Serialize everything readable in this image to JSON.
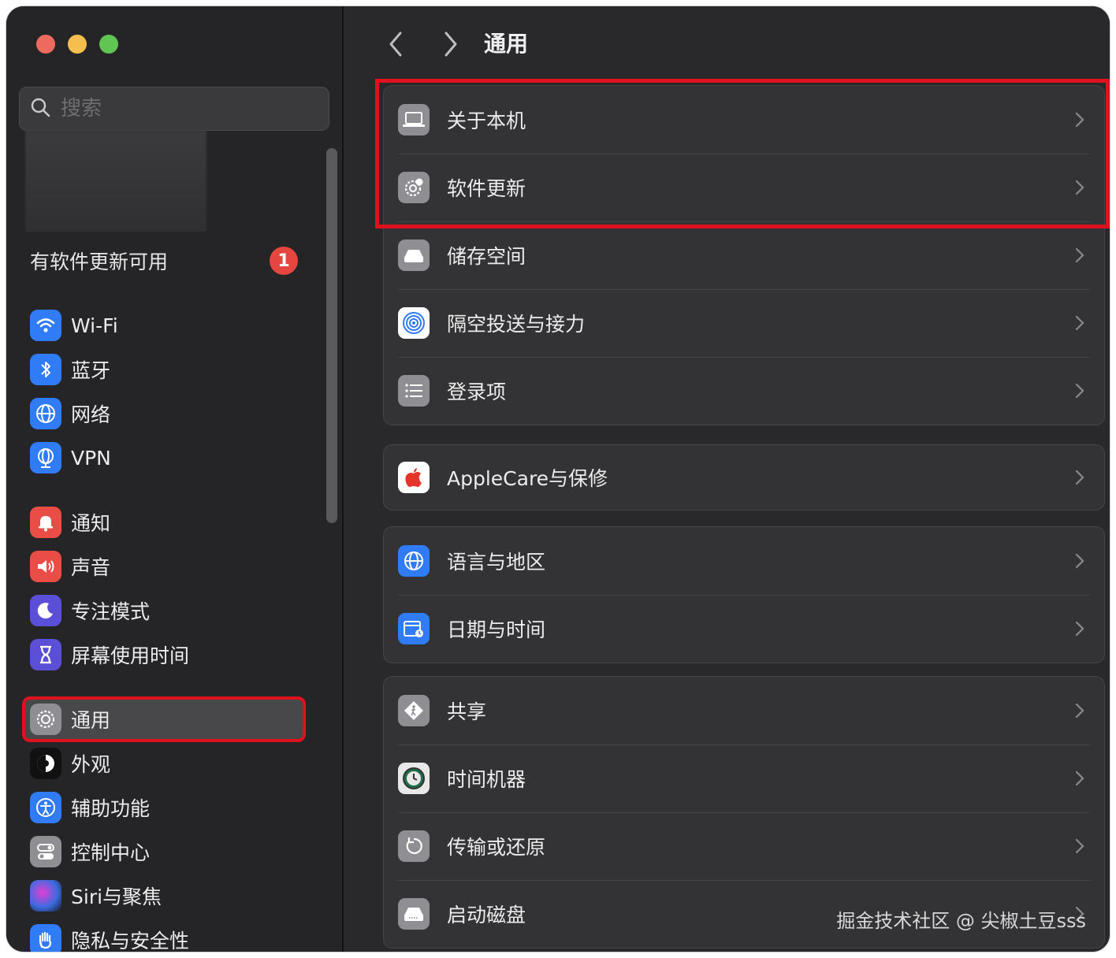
{
  "sidebar": {
    "search_placeholder": "搜索",
    "update_text": "有软件更新可用",
    "update_badge": "1",
    "items": [
      {
        "label": "Wi-Fi",
        "icon": "wifi-icon",
        "color": "#2f7cf6"
      },
      {
        "label": "蓝牙",
        "icon": "bluetooth-icon",
        "color": "#2f7cf6"
      },
      {
        "label": "网络",
        "icon": "globe-icon",
        "color": "#2f7cf6"
      },
      {
        "label": "VPN",
        "icon": "vpn-globe-icon",
        "color": "#2f7cf6"
      },
      {
        "label": "通知",
        "icon": "bell-icon",
        "color": "#ea4d46"
      },
      {
        "label": "声音",
        "icon": "speaker-icon",
        "color": "#ea4d46"
      },
      {
        "label": "专注模式",
        "icon": "moon-icon",
        "color": "#5b4fd8"
      },
      {
        "label": "屏幕使用时间",
        "icon": "hourglass-icon",
        "color": "#5b4fd8"
      },
      {
        "label": "通用",
        "icon": "gear-icon",
        "color": "#8e8e93"
      },
      {
        "label": "外观",
        "icon": "appearance-icon",
        "color": "#111111"
      },
      {
        "label": "辅助功能",
        "icon": "accessibility-icon",
        "color": "#2f7cf6"
      },
      {
        "label": "控制中心",
        "icon": "toggles-icon",
        "color": "#8e8e93"
      },
      {
        "label": "Siri与聚焦",
        "icon": "siri-icon",
        "color": "#4a3fb0"
      },
      {
        "label": "隐私与安全性",
        "icon": "hand-icon",
        "color": "#2f7cf6"
      }
    ]
  },
  "main": {
    "title": "通用",
    "groups": [
      {
        "rows": [
          {
            "label": "关于本机",
            "icon": "laptop-icon"
          },
          {
            "label": "软件更新",
            "icon": "gear-update-icon"
          },
          {
            "label": "储存空间",
            "icon": "drive-icon"
          },
          {
            "label": "隔空投送与接力",
            "icon": "airdrop-icon"
          },
          {
            "label": "登录项",
            "icon": "list-icon"
          }
        ]
      },
      {
        "rows": [
          {
            "label": "AppleCare与保修",
            "icon": "apple-icon"
          }
        ]
      },
      {
        "rows": [
          {
            "label": "语言与地区",
            "icon": "globe-icon"
          },
          {
            "label": "日期与时间",
            "icon": "calendar-clock-icon"
          }
        ]
      },
      {
        "rows": [
          {
            "label": "共享",
            "icon": "share-walk-icon"
          },
          {
            "label": "时间机器",
            "icon": "time-machine-icon"
          },
          {
            "label": "传输或还原",
            "icon": "restore-icon"
          },
          {
            "label": "启动磁盘",
            "icon": "startup-disk-icon"
          }
        ]
      }
    ]
  },
  "watermark": "掘金技术社区 @ 尖椒土豆sss"
}
